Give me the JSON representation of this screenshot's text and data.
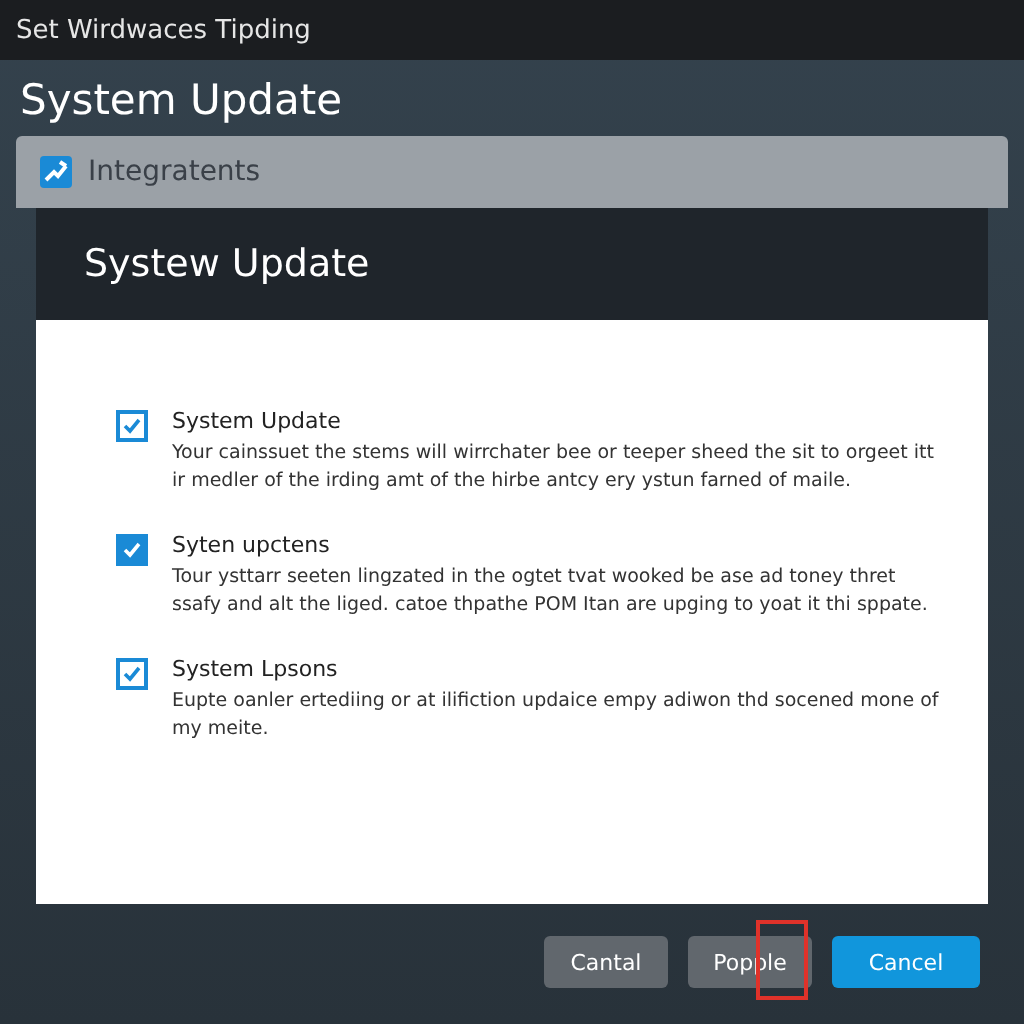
{
  "window": {
    "title": "Set  Wirdwaces Tipding"
  },
  "heading": "System Update",
  "section_bar": {
    "label": "Integratents"
  },
  "dialog": {
    "title": "Systew Update",
    "options": [
      {
        "kind": "outline",
        "checked": true,
        "title": "System Update",
        "description": "Your cainssuet the stems will wirrchater bee or teeper sheed the sit to orgeet itt ir medler of the irding amt of the hirbe antcy ery ystun farned of maile."
      },
      {
        "kind": "filled",
        "checked": true,
        "title": "Syten upctens",
        "description": "Tour ysttarr seeten lingzated in the ogtet tvat wooked be ase ad toney thret ssafy and alt the liged. catoe thpathe POM Itan are upging to yoat it thi sppate."
      },
      {
        "kind": "outline",
        "checked": true,
        "title": "System Lpsons",
        "description": "Eupte oanler ertediing or at ilifiction updaice empy adiwon thd socened mone of my meite."
      }
    ],
    "buttons": [
      {
        "label": "Cantal",
        "primary": false,
        "highlighted": false
      },
      {
        "label": "Popple",
        "primary": false,
        "highlighted": true
      },
      {
        "label": "Cancel",
        "primary": true,
        "highlighted": false
      }
    ]
  }
}
